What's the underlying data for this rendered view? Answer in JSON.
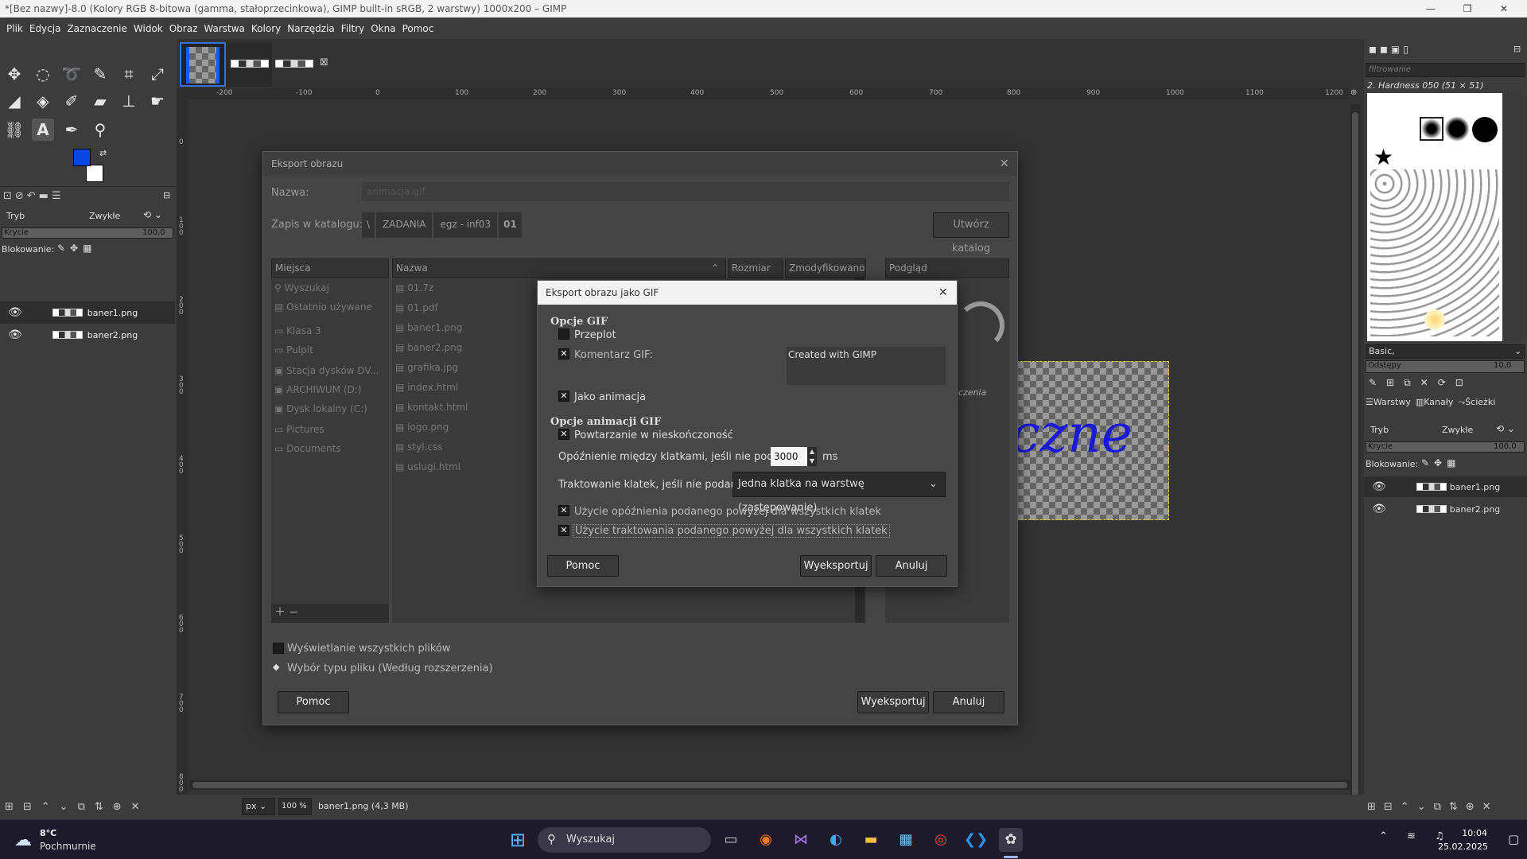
{
  "window": {
    "title": "*[Bez nazwy]-8.0 (Kolory RGB 8-bitowa (gamma, stałoprzecinkowa), GIMP built-in sRGB, 2 warstwy) 1000x200 – GIMP"
  },
  "menu": [
    "Plik",
    "Edycja",
    "Zaznaczenie",
    "Widok",
    "Obraz",
    "Warstwa",
    "Kolory",
    "Narzędzia",
    "Filtry",
    "Okna",
    "Pomoc"
  ],
  "left_panel": {
    "mode_label": "Tryb",
    "mode_value": "Zwykłe",
    "opacity_label": "Krycie",
    "opacity_value": "100,0",
    "lock_label": "Blokowanie:",
    "layers": [
      "baner1.png",
      "baner2.png"
    ]
  },
  "ruler_ticks": [
    "-200",
    "-100",
    "0",
    "100",
    "200",
    "300",
    "400",
    "500",
    "600",
    "700",
    "800",
    "900",
    "1000",
    "1100",
    "1200"
  ],
  "ruler_v_ticks": [
    "0",
    "1|0|0",
    "2|0|0",
    "3|0|0",
    "4|0|0",
    "5|0|0",
    "6|0|0",
    "7|0|0",
    "8|0|0"
  ],
  "canvas": {
    "text_preview": "rczne"
  },
  "statusbar": {
    "unit": "px",
    "zoom": "100 %",
    "info": "baner1.png (4,3 MB)"
  },
  "export_dialog": {
    "title": "Eksport obrazu",
    "name_label": "Nazwa:",
    "name_value": "animacja.gif",
    "folder_label": "Zapis w katalogu:",
    "path": [
      "\\",
      "ZADANIA",
      "egz - inf03",
      "01"
    ],
    "create_folder": "Utwórz katalog",
    "places_header": "Miejsca",
    "places": [
      "Wyszukaj",
      "Ostatnio używane",
      "Klasa 3",
      "Pulpit",
      "Stacja dysków DV...",
      "ARCHIWUM (D:)",
      "Dysk lokalny (C:)",
      "Pictures",
      "Documents"
    ],
    "columns": {
      "name": "Nazwa",
      "size": "Rozmiar",
      "modified": "Zmodyfikowano"
    },
    "files": [
      "01.7z",
      "01.pdf",
      "baner1.png",
      "baner2.png",
      "grafika.jpg",
      "index.html",
      "kontakt.html",
      "logo.png",
      "styl.css",
      "uslugi.html"
    ],
    "preview_header": "Podgląd",
    "preview_note": "czenia",
    "show_all": "Wyświetlanie wszystkich plików",
    "file_type": "Wybór typu pliku (Według rozszerzenia)",
    "help": "Pomoc",
    "export": "Wyeksportuj",
    "cancel": "Anuluj"
  },
  "gif_dialog": {
    "title": "Eksport obrazu jako GIF",
    "section1": "Opcje GIF",
    "interlace": "Przeplot",
    "comment_label": "Komentarz GIF:",
    "comment_value": "Created with GIMP",
    "as_animation": "Jako animacja",
    "section2": "Opcje animacji GIF",
    "loop": "Powtarzanie w nieskończoność",
    "delay_label": "Opóźnienie między klatkami, jeśli nie podano:",
    "delay_value": "3000",
    "delay_unit": "ms",
    "frame_label": "Traktowanie klatek, jeśli nie podano:",
    "frame_value": "Jedna klatka na warstwę (zastępowanie)",
    "use_delay": "Użycie opóźnienia podanego powyżej dla wszystkich klatek",
    "use_disposal": "Użycie traktowania podanego powyżej dla wszystkich klatek",
    "help": "Pomoc",
    "export": "Wyeksportuj",
    "cancel": "Anuluj"
  },
  "right_dock": {
    "filter_placeholder": "filtrowanie",
    "brush_name": "2. Hardness 050 (51 × 51)",
    "preset": "Basic,",
    "spacing_label": "Odstępy",
    "spacing_value": "10,0",
    "tabs": [
      "Warstwy",
      "Kanały",
      "Ścieżki"
    ],
    "mode_label": "Tryb",
    "mode_value": "Zwykłe",
    "opacity_label": "Krycie",
    "opacity_value": "100,0",
    "lock_label": "Blokowanie:",
    "layers": [
      "baner1.png",
      "baner2.png"
    ]
  },
  "taskbar": {
    "weather_temp": "8°C",
    "weather_desc": "Pochmurnie",
    "search": "Wyszukaj",
    "time": "10:04",
    "date": "25.02.2025"
  },
  "colors": {
    "fg": "#0a46e6",
    "bg": "#ffffff",
    "text_blue": "#1b1bd6"
  }
}
